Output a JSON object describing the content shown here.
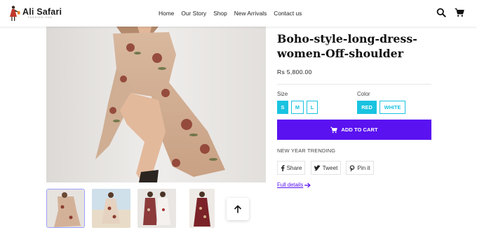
{
  "header": {
    "logo_name": "Ali Safari",
    "logo_tagline": "FASHION HUB",
    "nav": [
      "Home",
      "Our Story",
      "Shop",
      "New Arrivals",
      "Contact us"
    ],
    "icons": [
      "search-icon",
      "cart-icon"
    ]
  },
  "product": {
    "title": "Boho-style-long-dress-women-Off-shoulder",
    "price": "Rs 5,800.00",
    "size_label": "Size",
    "sizes": [
      "S",
      "M",
      "L"
    ],
    "selected_size": "S",
    "color_label": "Color",
    "colors": [
      "RED",
      "WHITE"
    ],
    "selected_color": "RED",
    "add_to_cart": "ADD TO CART",
    "trend_text": "NEW YEAR TRENDING",
    "share_label": "Share",
    "tweet_label": "Tweet",
    "pin_label": "Pin it",
    "full_details": "Full details"
  },
  "colors": {
    "accent_purple": "#5a12f0",
    "accent_cyan": "#19c3e0"
  }
}
